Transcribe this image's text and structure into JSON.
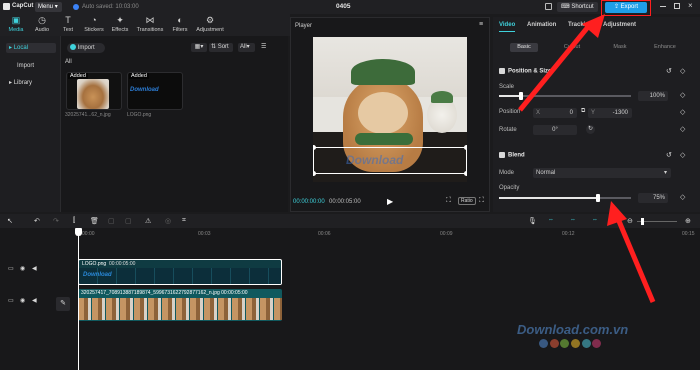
{
  "app": {
    "name": "CapCut",
    "menu_label": "Menu",
    "autosave": "Auto saved: 10:03:00",
    "project_title": "0405"
  },
  "titlebar": {
    "shortcut_label": "Shortcut",
    "export_label": "Export"
  },
  "toolbar": {
    "items": [
      {
        "label": "Media",
        "icon": "media-icon"
      },
      {
        "label": "Audio",
        "icon": "audio-icon"
      },
      {
        "label": "Text",
        "icon": "text-icon"
      },
      {
        "label": "Stickers",
        "icon": "stickers-icon"
      },
      {
        "label": "Effects",
        "icon": "effects-icon"
      },
      {
        "label": "Transitions",
        "icon": "transitions-icon"
      },
      {
        "label": "Filters",
        "icon": "filters-icon"
      },
      {
        "label": "Adjustment",
        "icon": "adjustment-icon"
      }
    ]
  },
  "leftnav": {
    "local": "Local",
    "import": "Import",
    "library": "Library"
  },
  "media": {
    "import_label": "Import",
    "sort_label": "Sort",
    "filter_label": "All",
    "section_label": "All",
    "items": [
      {
        "tag": "Added",
        "name": "32025741...62_n.jpg"
      },
      {
        "tag": "Added",
        "name": "LOGO.png",
        "overlay_text": "Download"
      }
    ]
  },
  "player": {
    "title": "Player",
    "current_time": "00:00:00:00",
    "total_time": "00:00:05:00",
    "ratio_label": "Ratio"
  },
  "properties": {
    "tabs": [
      "Video",
      "Animation",
      "Tracking",
      "Adjustment"
    ],
    "subtabs": [
      "Basic",
      "Cutout",
      "Mask",
      "Enhance"
    ],
    "position_size": "Position & Size",
    "scale_label": "Scale",
    "scale_value": "100%",
    "scale_level": 0.17,
    "position_label": "Position",
    "pos_x_label": "X",
    "pos_x": "0",
    "pos_y_label": "Y",
    "pos_y": "-1300",
    "rotate_label": "Rotate",
    "rotate_value": "0°",
    "blend_label": "Blend",
    "mode_label": "Mode",
    "mode_value": "Normal",
    "opacity_label": "Opacity",
    "opacity_value": "75%",
    "opacity_level": 0.75
  },
  "timeline": {
    "ruler": [
      "00:00",
      "00:03",
      "00:06",
      "00:09",
      "00:12",
      "00:15"
    ],
    "logo_clip": {
      "label": "LOGO.png",
      "duration": "00:00:05:00",
      "strip_text": "Download"
    },
    "main_clip": {
      "label": "320257417_708913887189874_5996731622792877162_n.jpg",
      "duration": "00:00:05:00"
    }
  },
  "watermark": {
    "text": "Download.com.vn"
  },
  "colors": {
    "accent": "#3fd2dc",
    "export": "#1f9ee8",
    "annotation": "#ff1f1f"
  }
}
